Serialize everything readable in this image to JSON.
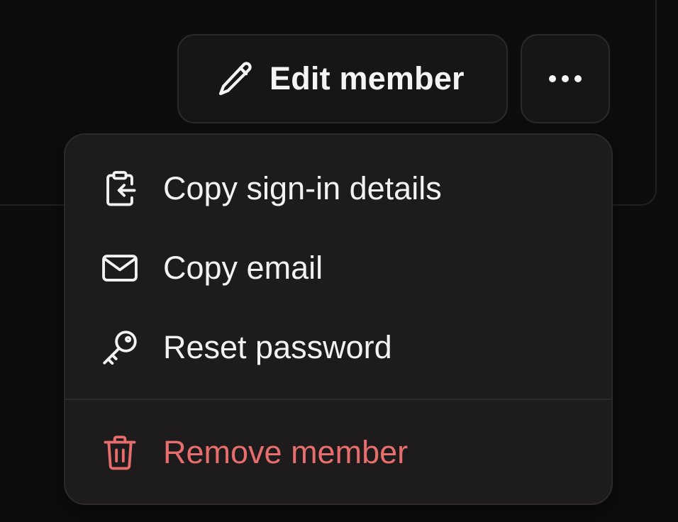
{
  "toolbar": {
    "edit_label": "Edit member",
    "edit_icon": "pencil-icon",
    "more_icon": "more-horizontal-icon"
  },
  "menu": {
    "items": [
      {
        "label": "Copy sign-in details",
        "icon": "clipboard-import-icon"
      },
      {
        "label": "Copy email",
        "icon": "mail-icon"
      },
      {
        "label": "Reset password",
        "icon": "key-icon"
      },
      {
        "label": "Remove member",
        "icon": "trash-icon",
        "destructive": true
      }
    ]
  },
  "colors": {
    "background": "#0e0d0e",
    "button_bg": "#171616",
    "menu_bg": "#1d1b1b",
    "text": "#f3f1f1",
    "destructive": "#e86d6d"
  }
}
